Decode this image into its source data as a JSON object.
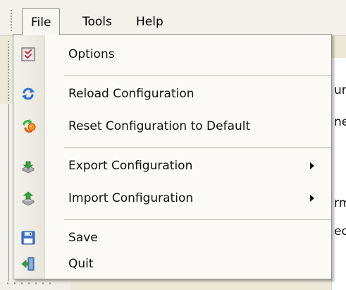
{
  "menubar": {
    "items": [
      {
        "label": "File"
      },
      {
        "label": "Tools"
      },
      {
        "label": "Help"
      }
    ]
  },
  "file_menu": {
    "items": [
      {
        "label": "Options",
        "icon": "checklist-icon"
      },
      {
        "label": "Reload Configuration",
        "icon": "reload-icon"
      },
      {
        "label": "Reset Configuration to Default",
        "icon": "reset-icon"
      },
      {
        "label": "Export Configuration",
        "icon": "export-icon",
        "submenu": true
      },
      {
        "label": "Import Configuration",
        "icon": "import-icon",
        "submenu": true
      },
      {
        "label": "Save",
        "icon": "floppy-disk-icon"
      },
      {
        "label": "Quit",
        "icon": "exit-door-icon"
      }
    ]
  },
  "background_fragments": [
    "ur",
    "ne",
    "rm",
    "ec"
  ]
}
